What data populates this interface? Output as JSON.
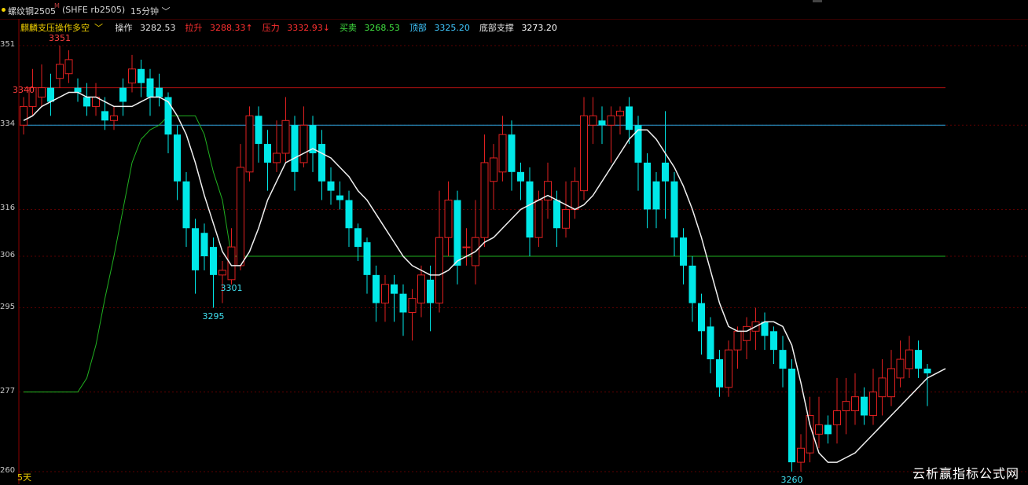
{
  "header": {
    "symbol": "螺纹钢2505",
    "symbol_sup": "M",
    "market": "(SHFE rb2505)",
    "period": "15分钟"
  },
  "indicator": {
    "name": "麒麟支压操作多空",
    "items": [
      {
        "label": "操作",
        "value": "3282.53",
        "color": "#e0e0e0"
      },
      {
        "label": "拉升",
        "value": "3288.33",
        "color": "#ff3030",
        "arrow": "↑"
      },
      {
        "label": "压力",
        "value": "3332.93",
        "color": "#ff3030",
        "arrow": "↓"
      },
      {
        "label": "买卖",
        "value": "3268.53",
        "color": "#40e040"
      },
      {
        "label": "顶部",
        "value": "3325.20",
        "color": "#40c8ff"
      },
      {
        "label": "底部支撑",
        "value": "3273.20",
        "color": "#ffffff"
      }
    ]
  },
  "footer": {
    "days": "5天",
    "watermark": "云析赢指标公式网"
  },
  "chart_data": {
    "type": "candlestick",
    "y_ticks": [
      "351",
      "334",
      "316",
      "306",
      "295",
      "277",
      "260"
    ],
    "y_tick_values": [
      3351,
      3334,
      3316,
      3306,
      3295,
      3277,
      3260
    ],
    "price_labels": [
      {
        "text": "3351",
        "value": 3351,
        "color": "#ff4040"
      },
      {
        "text": "3340",
        "value": 3340,
        "color": "#ff4040"
      },
      {
        "text": "3295",
        "value": 3295,
        "color": "#40e0f0"
      },
      {
        "text": "3301",
        "value": 3301,
        "color": "#40e0f0"
      },
      {
        "text": "3260",
        "value": 3260,
        "color": "#40e0f0"
      }
    ],
    "candles": [
      [
        3334,
        3338,
        3332,
        3340
      ],
      [
        3338,
        3342,
        3336,
        3346
      ],
      [
        3340,
        3342,
        3338,
        3347
      ],
      [
        3342,
        3339,
        3336,
        3345
      ],
      [
        3344,
        3347,
        3342,
        3351
      ],
      [
        3345,
        3348,
        3343,
        3350
      ],
      [
        3342,
        3341,
        3339,
        3344
      ],
      [
        3340,
        3338,
        3336,
        3343
      ],
      [
        3338,
        3340,
        3336,
        3343
      ],
      [
        3337,
        3335,
        3333,
        3340
      ],
      [
        3335,
        3336,
        3333,
        3338
      ],
      [
        3342,
        3339,
        3336,
        3344
      ],
      [
        3343,
        3346,
        3341,
        3349
      ],
      [
        3346,
        3343,
        3340,
        3348
      ],
      [
        3344,
        3340,
        3336,
        3346
      ],
      [
        3342,
        3340,
        3338,
        3345
      ],
      [
        3340,
        3332,
        3328,
        3341
      ],
      [
        3332,
        3322,
        3318,
        3334
      ],
      [
        3322,
        3312,
        3308,
        3324
      ],
      [
        3312,
        3303,
        3298,
        3314
      ],
      [
        3311,
        3306,
        3303,
        3313
      ],
      [
        3308,
        3302,
        3295,
        3310
      ],
      [
        3302,
        3303,
        3296,
        3305
      ],
      [
        3301,
        3308,
        3300,
        3312
      ],
      [
        3304,
        3325,
        3303,
        3330
      ],
      [
        3324,
        3336,
        3322,
        3338
      ],
      [
        3336,
        3330,
        3326,
        3338
      ],
      [
        3330,
        3326,
        3320,
        3333
      ],
      [
        3326,
        3328,
        3324,
        3335
      ],
      [
        3328,
        3335,
        3326,
        3340
      ],
      [
        3334,
        3324,
        3320,
        3336
      ],
      [
        3326,
        3334,
        3325,
        3338
      ],
      [
        3334,
        3328,
        3324,
        3336
      ],
      [
        3330,
        3322,
        3318,
        3333
      ],
      [
        3322,
        3320,
        3317,
        3325
      ],
      [
        3319,
        3318,
        3316,
        3322
      ],
      [
        3318,
        3312,
        3308,
        3320
      ],
      [
        3312,
        3308,
        3305,
        3313
      ],
      [
        3309,
        3302,
        3298,
        3310
      ],
      [
        3302,
        3296,
        3292,
        3304
      ],
      [
        3296,
        3300,
        3292,
        3302
      ],
      [
        3300,
        3298,
        3292,
        3302
      ],
      [
        3298,
        3294,
        3289,
        3300
      ],
      [
        3294,
        3297,
        3288,
        3299
      ],
      [
        3296,
        3302,
        3293,
        3304
      ],
      [
        3301,
        3296,
        3290,
        3304
      ],
      [
        3296,
        3310,
        3294,
        3320
      ],
      [
        3310,
        3318,
        3306,
        3322
      ],
      [
        3318,
        3304,
        3300,
        3320
      ],
      [
        3308,
        3308,
        3304,
        3312
      ],
      [
        3304,
        3310,
        3300,
        3318
      ],
      [
        3310,
        3326,
        3308,
        3332
      ],
      [
        3322,
        3327,
        3316,
        3330
      ],
      [
        3324,
        3332,
        3322,
        3336
      ],
      [
        3332,
        3324,
        3320,
        3335
      ],
      [
        3324,
        3322,
        3318,
        3326
      ],
      [
        3322,
        3310,
        3306,
        3325
      ],
      [
        3310,
        3318,
        3308,
        3320
      ],
      [
        3318,
        3322,
        3314,
        3326
      ],
      [
        3318,
        3312,
        3308,
        3320
      ],
      [
        3312,
        3316,
        3310,
        3322
      ],
      [
        3316,
        3322,
        3314,
        3325
      ],
      [
        3320,
        3336,
        3318,
        3340
      ],
      [
        3334,
        3336,
        3330,
        3340
      ],
      [
        3335,
        3334,
        3330,
        3338
      ],
      [
        3334,
        3336,
        3326,
        3338
      ],
      [
        3336,
        3337,
        3332,
        3338
      ],
      [
        3338,
        3333,
        3330,
        3340
      ],
      [
        3334,
        3326,
        3320,
        3336
      ],
      [
        3326,
        3316,
        3312,
        3328
      ],
      [
        3322,
        3316,
        3312,
        3324
      ],
      [
        3326,
        3322,
        3314,
        3337
      ],
      [
        3322,
        3310,
        3306,
        3324
      ],
      [
        3310,
        3304,
        3300,
        3312
      ],
      [
        3304,
        3296,
        3292,
        3306
      ],
      [
        3296,
        3290,
        3285,
        3298
      ],
      [
        3291,
        3284,
        3281,
        3293
      ],
      [
        3284,
        3278,
        3276,
        3286
      ],
      [
        3278,
        3286,
        3276,
        3288
      ],
      [
        3286,
        3290,
        3282,
        3291
      ],
      [
        3288,
        3291,
        3284,
        3293
      ],
      [
        3290,
        3292,
        3286,
        3295
      ],
      [
        3292,
        3289,
        3286,
        3294
      ],
      [
        3290,
        3286,
        3283,
        3291
      ],
      [
        3286,
        3282,
        3278,
        3289
      ],
      [
        3282,
        3262,
        3260,
        3284
      ],
      [
        3262,
        3265,
        3260,
        3268
      ],
      [
        3264,
        3272,
        3262,
        3276
      ],
      [
        3268,
        3270,
        3265,
        3276
      ],
      [
        3270,
        3268,
        3266,
        3272
      ],
      [
        3270,
        3273,
        3266,
        3280
      ],
      [
        3273,
        3275,
        3268,
        3280
      ],
      [
        3273,
        3276,
        3270,
        3281
      ],
      [
        3276,
        3272,
        3270,
        3278
      ],
      [
        3272,
        3277,
        3270,
        3282
      ],
      [
        3276,
        3280,
        3272,
        3284
      ],
      [
        3276,
        3282,
        3274,
        3286
      ],
      [
        3280,
        3284,
        3278,
        3288
      ],
      [
        3282,
        3286,
        3280,
        3289
      ],
      [
        3286,
        3282,
        3280,
        3288
      ],
      [
        3282,
        3281,
        3274,
        3283
      ]
    ],
    "lines": {
      "white_ma": [
        3335,
        3336,
        3338,
        3339,
        3340,
        3341,
        3341,
        3340,
        3340,
        3339,
        3338,
        3338,
        3338,
        3339,
        3340,
        3340,
        3339,
        3336,
        3332,
        3326,
        3319,
        3313,
        3307,
        3304,
        3304,
        3307,
        3312,
        3318,
        3322,
        3326,
        3327,
        3328,
        3329,
        3328,
        3327,
        3325,
        3323,
        3320,
        3318,
        3315,
        3312,
        3309,
        3306,
        3304,
        3303,
        3302,
        3302,
        3303,
        3305,
        3306,
        3307,
        3309,
        3310,
        3312,
        3314,
        3316,
        3317,
        3318,
        3319,
        3318,
        3317,
        3316,
        3317,
        3319,
        3322,
        3325,
        3328,
        3331,
        3333,
        3333,
        3331,
        3328,
        3325,
        3321,
        3316,
        3310,
        3303,
        3296,
        3291,
        3290,
        3290,
        3291,
        3292,
        3292,
        3291,
        3287,
        3279,
        3270,
        3264,
        3262,
        3262,
        3263,
        3264,
        3266,
        3268,
        3270,
        3272,
        3274,
        3276,
        3278,
        3280,
        3281,
        3282
      ],
      "green_step": [
        3277,
        3277,
        3277,
        3277,
        3277,
        3277,
        3277,
        3280,
        3287,
        3297,
        3306,
        3316,
        3326,
        3331,
        3333,
        3334,
        3336,
        3336,
        3336,
        3336,
        3332,
        3324,
        3318,
        3306,
        3306,
        3306,
        3306,
        3306,
        3306,
        3306,
        3306,
        3306,
        3306,
        3306,
        3306,
        3306,
        3306,
        3306,
        3306,
        3306,
        3306,
        3306,
        3306,
        3306,
        3306,
        3306,
        3306,
        3306,
        3306,
        3306,
        3306,
        3306,
        3306,
        3306,
        3306,
        3306,
        3306,
        3306,
        3306,
        3306,
        3306,
        3306,
        3306,
        3306,
        3306,
        3306,
        3306,
        3306,
        3306,
        3306,
        3306,
        3306,
        3306,
        3306,
        3306,
        3306,
        3306,
        3306,
        3306,
        3306,
        3306,
        3306,
        3306,
        3306,
        3306,
        3306,
        3306,
        3306,
        3306,
        3306,
        3306,
        3306,
        3306,
        3306,
        3306,
        3306,
        3306,
        3306,
        3306,
        3306,
        3306,
        3306,
        3306
      ],
      "red_top": [
        3342,
        3342,
        3342,
        3342,
        3342,
        3342,
        3342,
        3342,
        3342,
        3342,
        3342,
        3342,
        3342,
        3342,
        3342,
        3342,
        3342,
        3342,
        3342,
        3342,
        3342,
        3342,
        3342,
        3342,
        3342,
        3342,
        3342,
        3342,
        3342,
        3342,
        3342,
        3342,
        3342,
        3342,
        3342,
        3342,
        3342,
        3342,
        3342,
        3342,
        3342,
        3342,
        3342,
        3342,
        3342,
        3342,
        3342,
        3342,
        3342,
        3342,
        3342,
        3342,
        3342,
        3342,
        3342,
        3342,
        3342,
        3342,
        3342,
        3342,
        3342,
        3342,
        3342,
        3342,
        3342,
        3342,
        3342,
        3342,
        3342,
        3342,
        3342,
        3342,
        3342,
        3342,
        3342,
        3342,
        3342,
        3342,
        3342,
        3342,
        3342,
        3342,
        3342,
        3342,
        3342,
        3342,
        3342,
        3342,
        3342,
        3342,
        3342,
        3342,
        3342,
        3342,
        3342,
        3342,
        3342,
        3342,
        3342,
        3342,
        3342,
        3342,
        3342
      ],
      "blue_top": [
        3334,
        3334,
        3334,
        3334,
        3334,
        3334,
        3334,
        3334,
        3334,
        3334,
        3334,
        3334,
        3334,
        3334,
        3334,
        3334,
        3334,
        3334,
        3334,
        3334,
        3334,
        3334,
        3334,
        3334,
        3334,
        3334,
        3334,
        3334,
        3334,
        3334,
        3334,
        3334,
        3334,
        3334,
        3334,
        3334,
        3334,
        3334,
        3334,
        3334,
        3334,
        3334,
        3334,
        3334,
        3334,
        3334,
        3334,
        3334,
        3334,
        3334,
        3334,
        3334,
        3334,
        3334,
        3334,
        3334,
        3334,
        3334,
        3334,
        3334,
        3334,
        3334,
        3334,
        3334,
        3334,
        3334,
        3334,
        3334,
        3334,
        3334,
        3334,
        3334,
        3334,
        3334,
        3334,
        3334,
        3334,
        3334,
        3334,
        3334,
        3334,
        3334,
        3334,
        3334,
        3334,
        3334,
        3334,
        3334,
        3334,
        3334,
        3334,
        3334,
        3334,
        3334,
        3334,
        3334,
        3334,
        3334,
        3334,
        3334,
        3334,
        3334,
        3334
      ]
    }
  }
}
